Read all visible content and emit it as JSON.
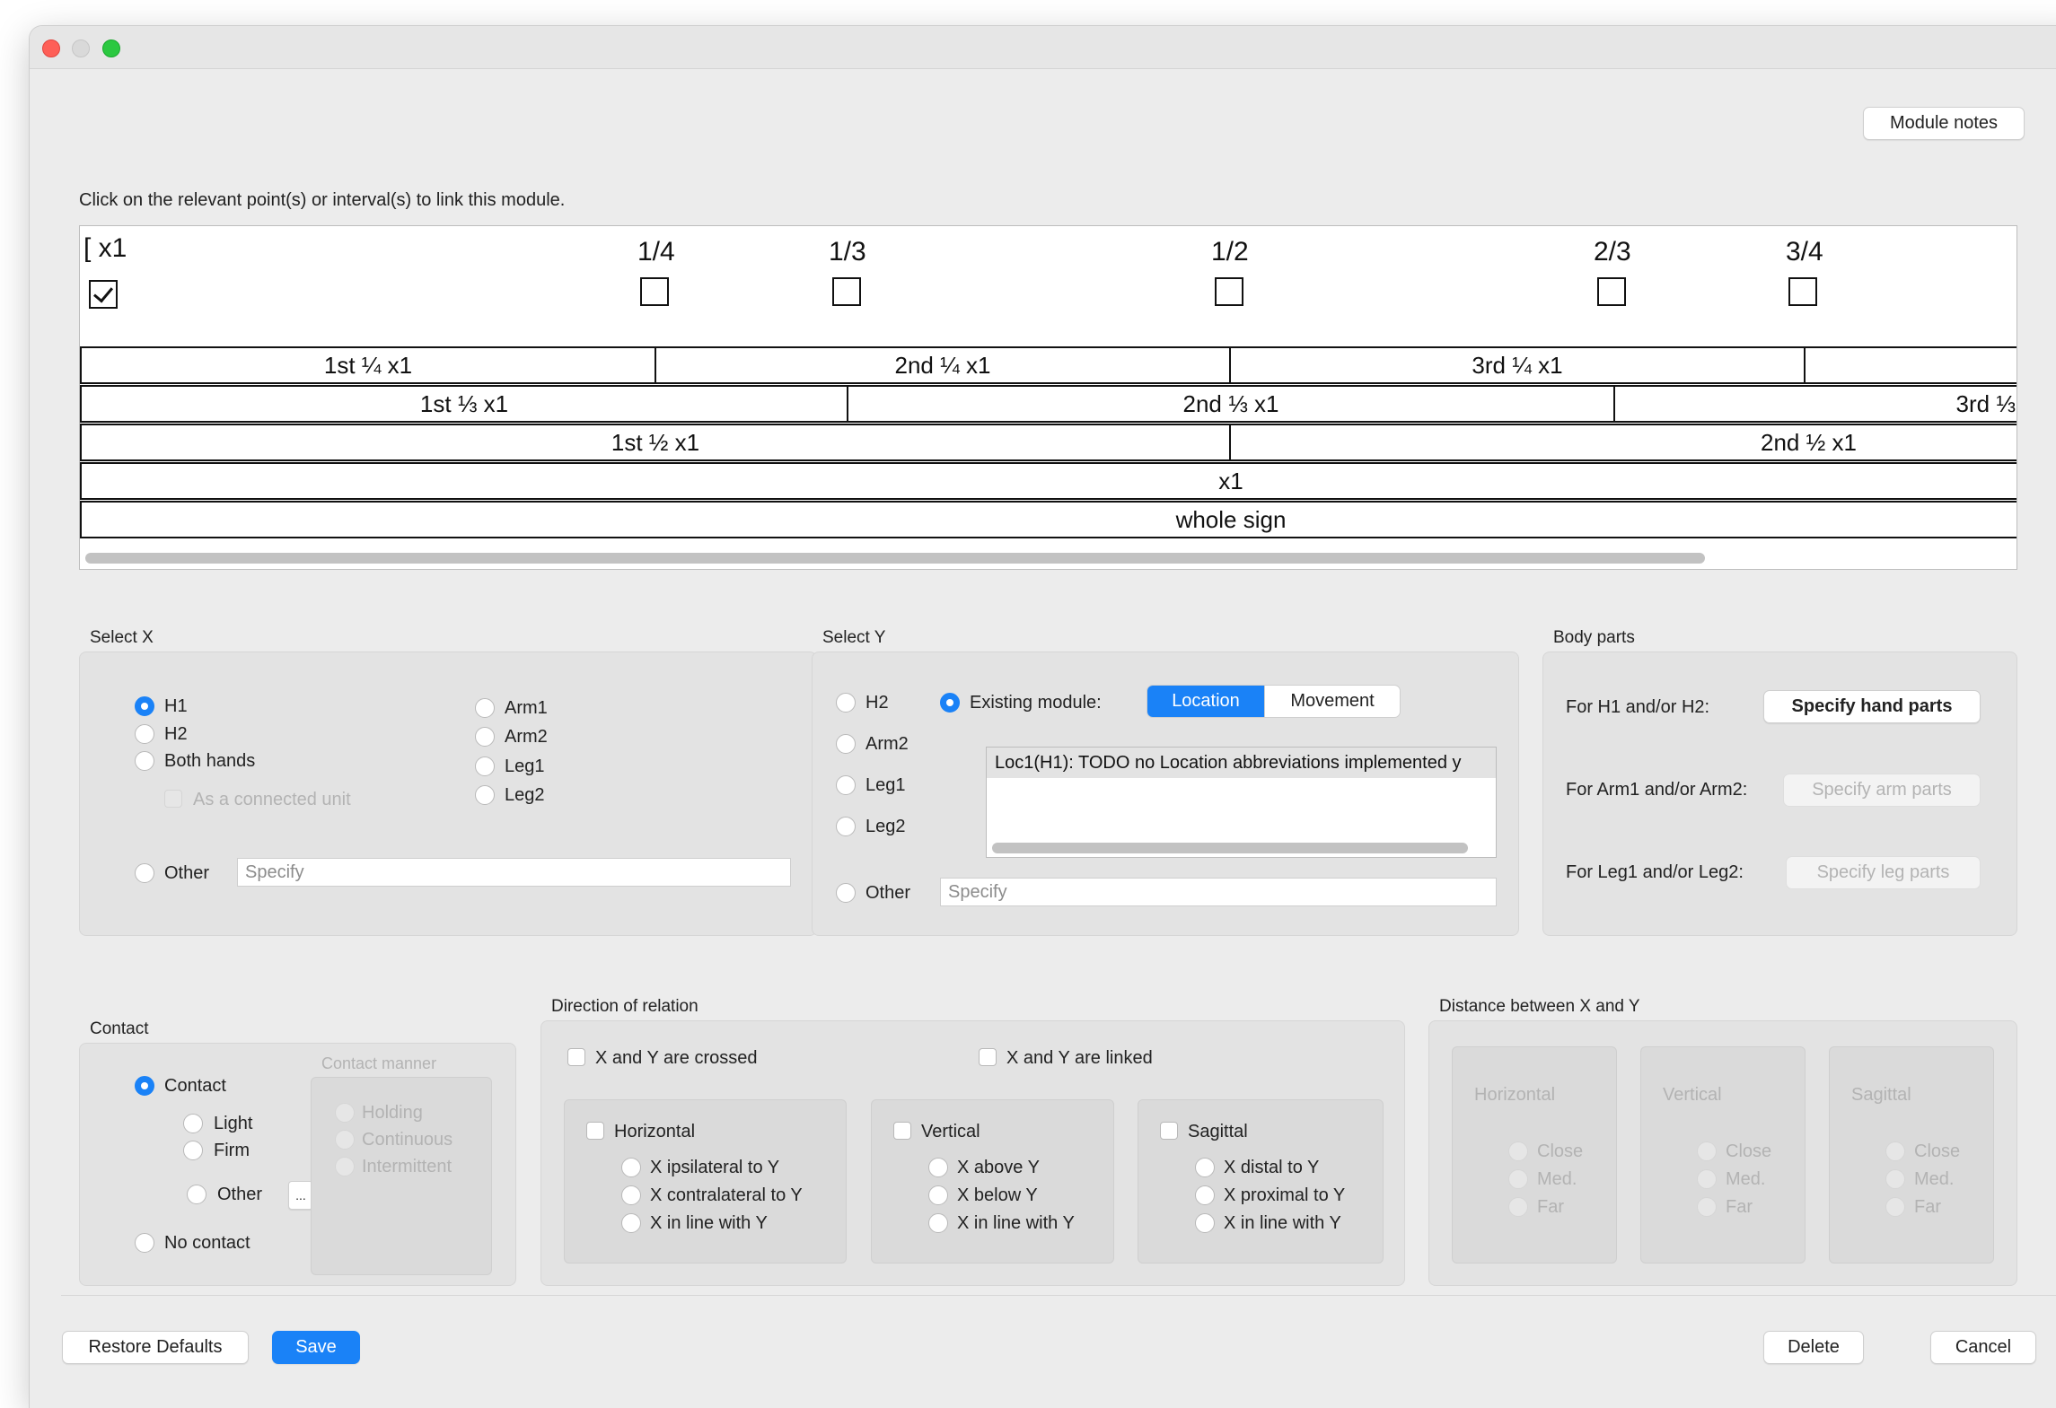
{
  "toolbar": {
    "module_notes": "Module notes"
  },
  "instruction": "Click on the relevant point(s) or interval(s) to link this module.",
  "timeline": {
    "points": [
      {
        "label": "[ x1",
        "checked": true
      },
      {
        "label": "1/4",
        "checked": false
      },
      {
        "label": "1/3",
        "checked": false
      },
      {
        "label": "1/2",
        "checked": false
      },
      {
        "label": "2/3",
        "checked": false
      },
      {
        "label": "3/4",
        "checked": false
      }
    ],
    "rows": [
      [
        "1st ¼ x1",
        "2nd ¼ x1",
        "3rd ¼ x1",
        ""
      ],
      [
        "1st ⅓ x1",
        "2nd ⅓ x1",
        "3rd ⅓"
      ],
      [
        "1st ½ x1",
        "2nd ½ x1"
      ],
      [
        "x1"
      ],
      [
        "whole sign"
      ]
    ]
  },
  "select_x": {
    "title": "Select X",
    "h1": "H1",
    "h2": "H2",
    "both": "Both hands",
    "connected": "As a connected unit",
    "arm1": "Arm1",
    "arm2": "Arm2",
    "leg1": "Leg1",
    "leg2": "Leg2",
    "other": "Other",
    "specify_placeholder": "Specify",
    "selected": "H1"
  },
  "select_y": {
    "title": "Select Y",
    "h2": "H2",
    "arm2": "Arm2",
    "leg1": "Leg1",
    "leg2": "Leg2",
    "existing": "Existing module:",
    "seg_location": "Location",
    "seg_movement": "Movement",
    "list_item": "Loc1(H1): TODO no Location abbreviations implemented y",
    "other": "Other",
    "specify_placeholder": "Specify",
    "selected": "Existing module:"
  },
  "body_parts": {
    "title": "Body parts",
    "h_label": "For H1 and/or H2:",
    "h_button": "Specify hand parts",
    "arm_label": "For Arm1 and/or Arm2:",
    "arm_button": "Specify arm parts",
    "leg_label": "For Leg1 and/or Leg2:",
    "leg_button": "Specify leg parts"
  },
  "contact": {
    "title": "Contact",
    "contact": "Contact",
    "light": "Light",
    "firm": "Firm",
    "other": "Other",
    "more": "...",
    "no_contact": "No contact",
    "manner_title": "Contact manner",
    "holding": "Holding",
    "continuous": "Continuous",
    "intermittent": "Intermittent",
    "selected": "Contact"
  },
  "direction": {
    "title": "Direction of relation",
    "crossed": "X and Y are crossed",
    "linked": "X and Y are linked",
    "horizontal": {
      "title": "Horizontal",
      "opts": [
        "X ipsilateral to Y",
        "X contralateral to Y",
        "X in line with Y"
      ]
    },
    "vertical": {
      "title": "Vertical",
      "opts": [
        "X above Y",
        "X below Y",
        "X in line with Y"
      ]
    },
    "sagittal": {
      "title": "Sagittal",
      "opts": [
        "X distal to Y",
        "X proximal to Y",
        "X in line with Y"
      ]
    }
  },
  "distance": {
    "title": "Distance between X and Y",
    "groups": [
      {
        "title": "Horizontal",
        "opts": [
          "Close",
          "Med.",
          "Far"
        ]
      },
      {
        "title": "Vertical",
        "opts": [
          "Close",
          "Med.",
          "Far"
        ]
      },
      {
        "title": "Sagittal",
        "opts": [
          "Close",
          "Med.",
          "Far"
        ]
      }
    ]
  },
  "footer": {
    "restore": "Restore Defaults",
    "save": "Save",
    "delete": "Delete",
    "cancel": "Cancel"
  },
  "colors": {
    "accent": "#1a82f7",
    "window_bg": "#ececec"
  }
}
